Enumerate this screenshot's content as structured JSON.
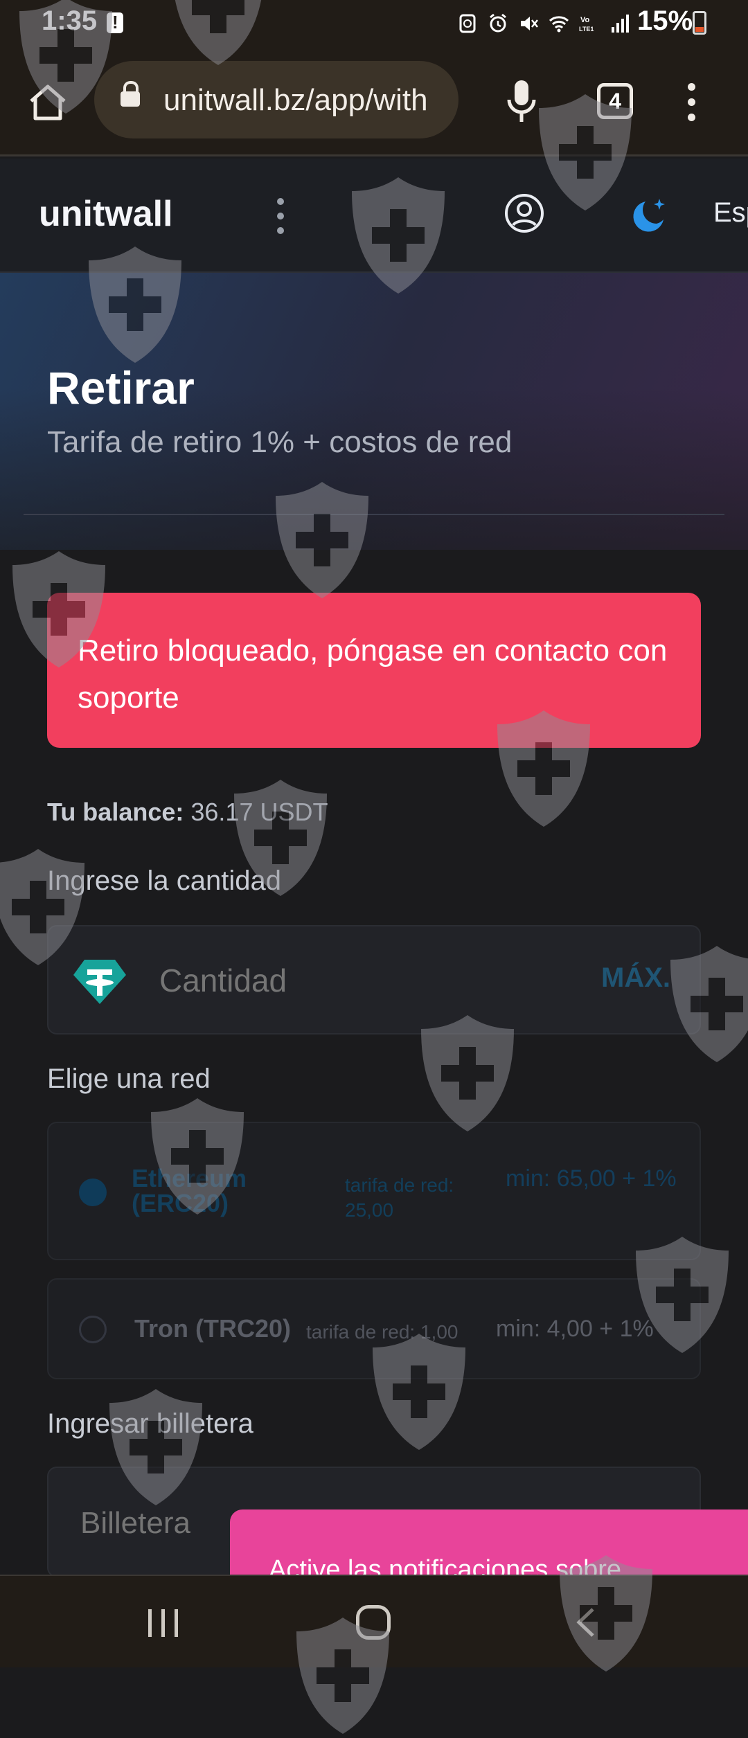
{
  "status_bar": {
    "time": "1:35",
    "battery": "15%",
    "network": "VoLTE1"
  },
  "browser": {
    "url": "unitwall.bz/app/with",
    "tab_count": "4"
  },
  "header": {
    "logo": "unitwall",
    "language": "Esp"
  },
  "page": {
    "title": "Retirar",
    "subtitle": "Tarifa de retiro 1% + costos de red",
    "alert": "Retiro bloqueado, póngase en contacto con soporte",
    "balance_label": "Tu balance:",
    "balance_value": "36.17 USDT",
    "amount_label": "Ingrese la cantidad",
    "amount_placeholder": "Cantidad",
    "max_label": "MÁX.",
    "network_label": "Elige una red",
    "networks": [
      {
        "name": "Ethereum (ERC20)",
        "fee": "tarifa de red: 25,00",
        "min": "min: 65,00 + 1%"
      },
      {
        "name": "Tron (TRC20)",
        "fee": "tarifa de red: 1,00",
        "min": "min: 4,00 + 1%"
      }
    ],
    "wallet_label": "Ingresar billetera",
    "wallet_placeholder": "Billetera",
    "notification_text": "Active las notificaciones sobre"
  },
  "colors": {
    "alert": "#f23f5e",
    "accent": "#e8449a",
    "selected_radio": "#0f3b59"
  }
}
